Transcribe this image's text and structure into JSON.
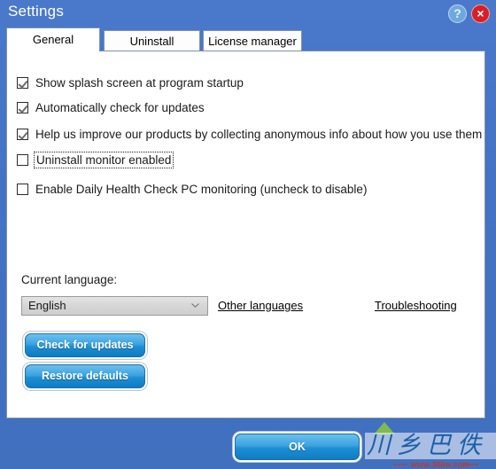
{
  "window": {
    "title": "Settings"
  },
  "titlebar": {
    "help_label": "?",
    "close_label": "×"
  },
  "tabs": [
    {
      "label": "General",
      "active": true
    },
    {
      "label": "Uninstall",
      "active": false
    },
    {
      "label": "License manager",
      "active": false
    }
  ],
  "options": [
    {
      "label": "Show splash screen at program startup",
      "checked": true,
      "focused": false
    },
    {
      "label": "Automatically check for updates",
      "checked": true,
      "focused": false
    },
    {
      "label": "Help us improve our products by collecting anonymous info about how you use them",
      "checked": true,
      "focused": false
    },
    {
      "label": "Uninstall monitor enabled",
      "checked": false,
      "focused": true
    },
    {
      "label": "Enable Daily Health Check PC monitoring (uncheck to disable)",
      "checked": false,
      "focused": false
    }
  ],
  "language": {
    "label": "Current language:",
    "selected": "English",
    "options": [
      "English"
    ]
  },
  "links": {
    "other_languages": "Other languages",
    "troubleshooting": "Troubleshooting"
  },
  "buttons": {
    "check_updates": "Check for updates",
    "restore_defaults": "Restore defaults",
    "ok": "OK"
  },
  "watermark": {
    "url": "www.306w.com",
    "characters": "川乡巴佬"
  },
  "colors": {
    "window_blue": "#4472c4",
    "title_text": "#ffffff",
    "panel_white": "#ffffff",
    "panel_border": "#7d92ab",
    "button_blue_top": "#6cc0ee",
    "button_blue_bottom": "#0d7cc4",
    "close_red": "#d61f26",
    "help_blue": "#6fa8dc",
    "dropdown_gray": "#d6d6d6"
  }
}
